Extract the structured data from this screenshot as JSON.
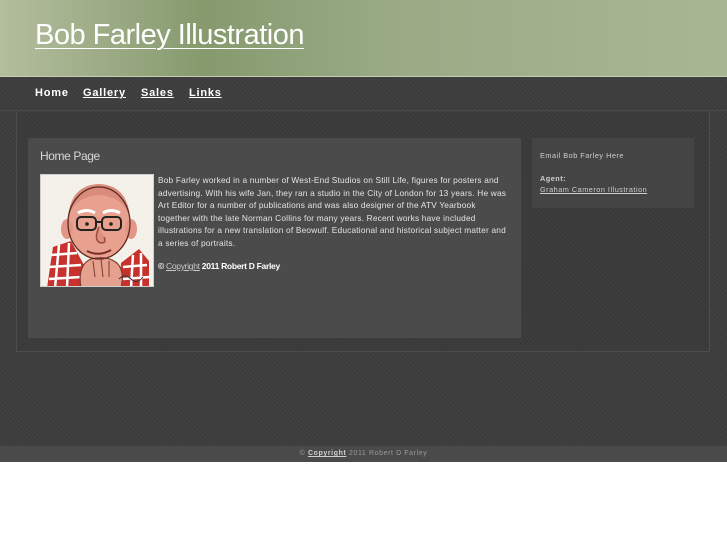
{
  "header": {
    "title": "Bob Farley Illustration"
  },
  "nav": {
    "home": "Home",
    "gallery": "Gallery",
    "sales": "Sales",
    "links": "Links"
  },
  "main": {
    "title": "Home Page",
    "portrait_icon": "caricature-portrait",
    "bio": "Bob Farley worked in a number of West-End Studios on Still Life, figures for posters and advertising. With his wife Jan, they ran a studio in the City of London for 13 years. He was Art Editor for a number of publications and was also designer of the ATV Yearbook together with the late Norman Collins for many years. Recent works have included illustrations for a new translation of Beowulf. Educational and historical subject matter and a series of portraits.",
    "copyright": {
      "symbol": "©",
      "link": "Copyright",
      "text": "2011 Robert D Farley"
    }
  },
  "sidebar": {
    "email_link": "Email Bob Farley Here",
    "agent_label": "Agent:",
    "agent_link": "Graham Cameron Illustration"
  },
  "footer": {
    "symbol": "©",
    "link": "Copyright",
    "text": "2011 Robert D Farley"
  },
  "colors": {
    "header_green": "#869a6e",
    "background_dark": "#3c3c3c",
    "box": "#4b4b4b"
  }
}
